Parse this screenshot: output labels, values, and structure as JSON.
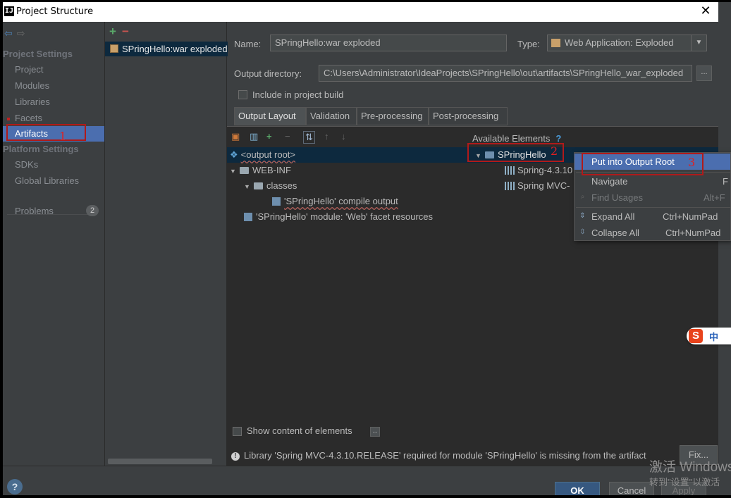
{
  "window": {
    "title": "Project Structure",
    "app_icon": "IJ"
  },
  "leftnav": {
    "sections": [
      {
        "heading": "Project Settings",
        "items": [
          "Project",
          "Modules",
          "Libraries",
          "Facets",
          "Artifacts"
        ]
      },
      {
        "heading": "Platform Settings",
        "items": [
          "SDKs",
          "Global Libraries"
        ]
      }
    ],
    "problems_label": "Problems",
    "problems_count": "2",
    "selected": "Artifacts"
  },
  "artifact_list": {
    "items": [
      "SPringHello:war exploded"
    ]
  },
  "form": {
    "name_label": "Name:",
    "name_value": "SPringHello:war exploded",
    "type_label": "Type:",
    "type_value": "Web Application: Exploded",
    "output_dir_label": "Output directory:",
    "output_dir_value": "C:\\Users\\Administrator\\IdeaProjects\\SPringHello\\out\\artifacts\\SPringHello_war_exploded",
    "browse_label": "...",
    "include_build_label": "Include in project build"
  },
  "tabs": [
    "Output Layout",
    "Validation",
    "Pre-processing",
    "Post-processing"
  ],
  "layout_tree": [
    {
      "label": "<output root>",
      "level": 0
    },
    {
      "label": "WEB-INF",
      "level": 0
    },
    {
      "label": "classes",
      "level": 1
    },
    {
      "label": "'SPringHello' compile output",
      "level": 2
    },
    {
      "label": "'SPringHello' module: 'Web' facet resources",
      "level": 0
    }
  ],
  "available": {
    "heading": "Available Elements",
    "help": "?",
    "items": [
      "SPringHello",
      "Spring-4.3.10",
      "Spring MVC-"
    ]
  },
  "context_menu": {
    "items": [
      {
        "label": "Put into Output Root",
        "shortcut": ""
      },
      {
        "label": "Navigate",
        "shortcut": "F"
      },
      {
        "label": "Find Usages",
        "shortcut": "Alt+F"
      },
      {
        "label": "Expand All",
        "shortcut": "Ctrl+NumPad"
      },
      {
        "label": "Collapse All",
        "shortcut": "Ctrl+NumPad"
      }
    ]
  },
  "show_content_label": "Show content of elements",
  "show_content_btn": "...",
  "warning": "Library 'Spring MVC-4.3.10.RELEASE' required for module 'SPringHello' is missing from the artifact",
  "fix_label": "Fix...",
  "buttons": {
    "ok": "OK",
    "cancel": "Cancel",
    "apply": "Apply"
  },
  "annotations": [
    "1",
    "2",
    "3"
  ],
  "watermark": {
    "line1": "激活 Windows",
    "line2": "转到\"设置\"以激活"
  },
  "ime": {
    "logo": "S",
    "mode": "中"
  },
  "colors": {
    "selection": "#4b6eaf",
    "tree_selection": "#0d293e",
    "annotation": "#b01a1a",
    "ok_button": "#365880"
  }
}
